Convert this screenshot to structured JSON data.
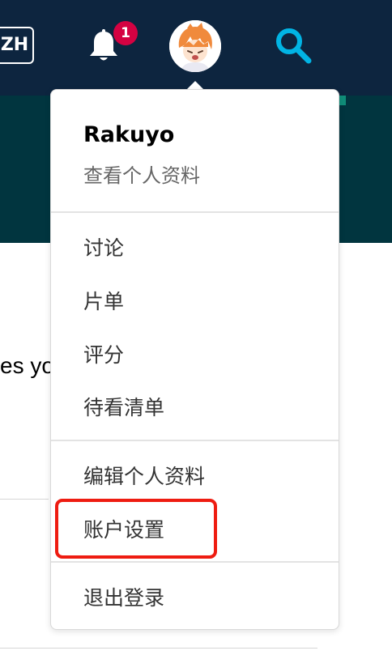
{
  "navbar": {
    "language_label": "ZH",
    "notification_count": "1",
    "icons": [
      "bell-icon",
      "avatar",
      "search-icon"
    ]
  },
  "page": {
    "partial_text": "es yo"
  },
  "dropdown": {
    "username": "Rakuyo",
    "view_profile": "查看个人资料",
    "group1": [
      "讨论",
      "片单",
      "评分",
      "待看清单"
    ],
    "group2": [
      "编辑个人资料",
      "账户设置"
    ],
    "logout": "退出登录",
    "highlighted_item": "账户设置"
  },
  "colors": {
    "navbar": "#0d253f",
    "hero": "#01353f",
    "badge": "#d40242",
    "search": "#01b4e4",
    "highlight": "#ee1c11"
  }
}
